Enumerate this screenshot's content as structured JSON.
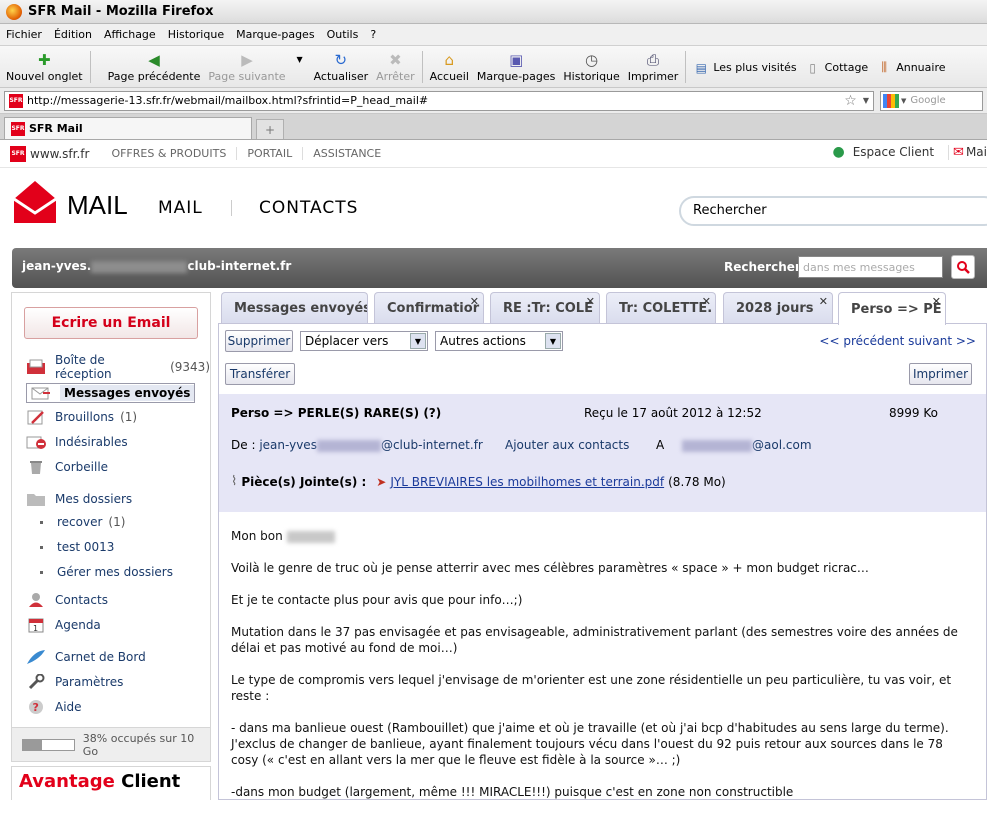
{
  "browser": {
    "title": "SFR Mail - Mozilla Firefox",
    "menu": [
      "Fichier",
      "Édition",
      "Affichage",
      "Historique",
      "Marque-pages",
      "Outils",
      "?"
    ],
    "toolbar": {
      "new_tab": "Nouvel onglet",
      "back": "Page précédente",
      "forward": "Page suivante",
      "reload": "Actualiser",
      "stop": "Arrêter",
      "home": "Accueil",
      "bookmarks": "Marque-pages",
      "history": "Historique",
      "print": "Imprimer"
    },
    "bookmarks": [
      "Les plus visités",
      "Cottage",
      "Annuaire"
    ],
    "url": "http://messagerie-13.sfr.fr/webmail/mailbox.html?sfrintid=P_head_mail#",
    "search_placeholder": "Google",
    "tab": "SFR Mail",
    "new_tab_symbol": "+"
  },
  "sfr_top": {
    "site": "www.sfr.fr",
    "links": [
      "OFFRES & PRODUITS",
      "PORTAIL",
      "ASSISTANCE"
    ],
    "espace": "Espace Client",
    "mail_short": "Mai"
  },
  "header": {
    "mail_logo": "MAIL",
    "nav": [
      "MAIL",
      "CONTACTS"
    ],
    "search": "Rechercher"
  },
  "userbar": {
    "email_start": "jean-yves.",
    "email_end": "club-internet.fr",
    "search_label": "Rechercher",
    "search_placeholder": "dans mes messages"
  },
  "sidebar": {
    "compose": "Ecrire un Email",
    "items": [
      {
        "label": "Boîte de réception",
        "count": "(9343)"
      },
      {
        "label": "Messages envoyés",
        "count": ""
      },
      {
        "label": "Brouillons",
        "count": "(1)"
      },
      {
        "label": "Indésirables",
        "count": ""
      },
      {
        "label": "Corbeille",
        "count": ""
      },
      {
        "label": "Mes dossiers",
        "count": ""
      }
    ],
    "subfolders": [
      {
        "label": "recover",
        "count": "(1)"
      },
      {
        "label": "test 0013",
        "count": ""
      },
      {
        "label": "Gérer mes dossiers",
        "count": ""
      }
    ],
    "tools": [
      "Contacts",
      "Agenda",
      "Carnet de Bord",
      "Paramètres",
      "Aide"
    ],
    "quota_text": "38% occupés sur 10 Go",
    "quota_fraction": 0.38,
    "avantage_a": "Avantage",
    "avantage_b": "Client"
  },
  "tabs": [
    "Messages envoyés",
    "Confirmatior",
    "RE :Tr: COLE",
    "Tr: COLETTE.",
    "2028 jours",
    "Perso => PE"
  ],
  "actions": {
    "delete": "Supprimer",
    "move": "Déplacer vers",
    "other": "Autres actions",
    "nav": "<< précédent suivant >>",
    "forward": "Transférer",
    "print": "Imprimer"
  },
  "message": {
    "subject": "Perso => PERLE(S) RARE(S) (?)",
    "received": "Reçu le 17 août 2012 à 12:52",
    "size": "8999 Ko",
    "from_label": "De :",
    "from_start": "jean-yves",
    "from_end": "@club-internet.fr",
    "add_contact": "Ajouter aux contacts",
    "to_label": "A",
    "to_end": "@aol.com",
    "attach_label": "Pièce(s) Jointe(s) :",
    "attach_name": "JYL BREVIAIRES les mobilhomes et terrain.pdf",
    "attach_size": "(8.78 Mo)",
    "body": [
      "Mon bon",
      "Voilà le genre de truc où je pense atterrir avec mes célèbres paramètres « space » + mon budget ricrac…",
      "Et je te contacte plus pour avis que pour info…;)",
      "Mutation dans le 37 pas envisagée et pas envisageable, administrativement parlant (des semestres voire des années de délai et pas motivé au fond de moi…)",
      "Le type de compromis vers lequel j'envisage de m'orienter est une zone résidentielle un peu particulière, tu vas voir, et reste :",
      "- dans ma banlieue ouest (Rambouillet) que j'aime et où je travaille (et où j'ai bcp d'habitudes au sens large du terme). J'exclus de changer de banlieue, ayant finalement toujours vécu dans l'ouest du 92 puis retour aux sources dans le 78 cosy (« c'est en allant vers la mer que le fleuve est fidèle à la source »…   ;)",
      "-dans mon budget (largement, même !!! MIRACLE!!!) puisque c'est en zone non constructible"
    ]
  }
}
